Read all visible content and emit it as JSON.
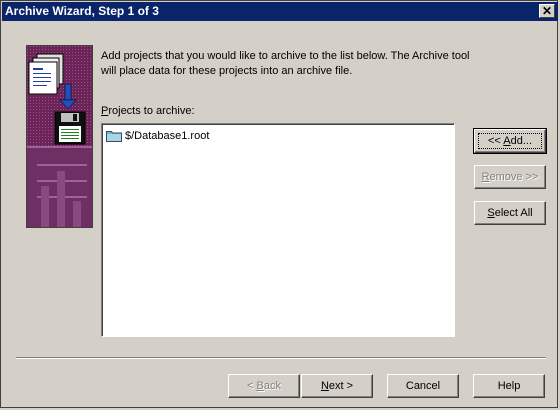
{
  "window": {
    "title": "Archive Wizard, Step 1 of 3",
    "close_glyph": "✕"
  },
  "description": "Add projects that you would like to archive to the list below.  The Archive tool will place data for these projects into an archive file.",
  "list": {
    "label_accel": "P",
    "label_rest": "rojects to archive:",
    "items": [
      {
        "label": "$/Database1.root",
        "icon": "folder-icon"
      }
    ]
  },
  "side_buttons": {
    "add": {
      "pre": "<< ",
      "accel": "A",
      "post": "dd..."
    },
    "remove": {
      "pre": "",
      "accel": "R",
      "post": "emove >>"
    },
    "select_all": {
      "pre": "",
      "accel": "S",
      "post": "elect All"
    }
  },
  "footer_buttons": {
    "back": {
      "pre": "< ",
      "accel": "B",
      "post": "ack"
    },
    "next": {
      "pre": "",
      "accel": "N",
      "post": "ext >"
    },
    "cancel": "Cancel",
    "help": "Help"
  },
  "colors": {
    "titlebar": "#0a246a",
    "face": "#d4d0c8",
    "image_bg": "#5a1a4a"
  }
}
